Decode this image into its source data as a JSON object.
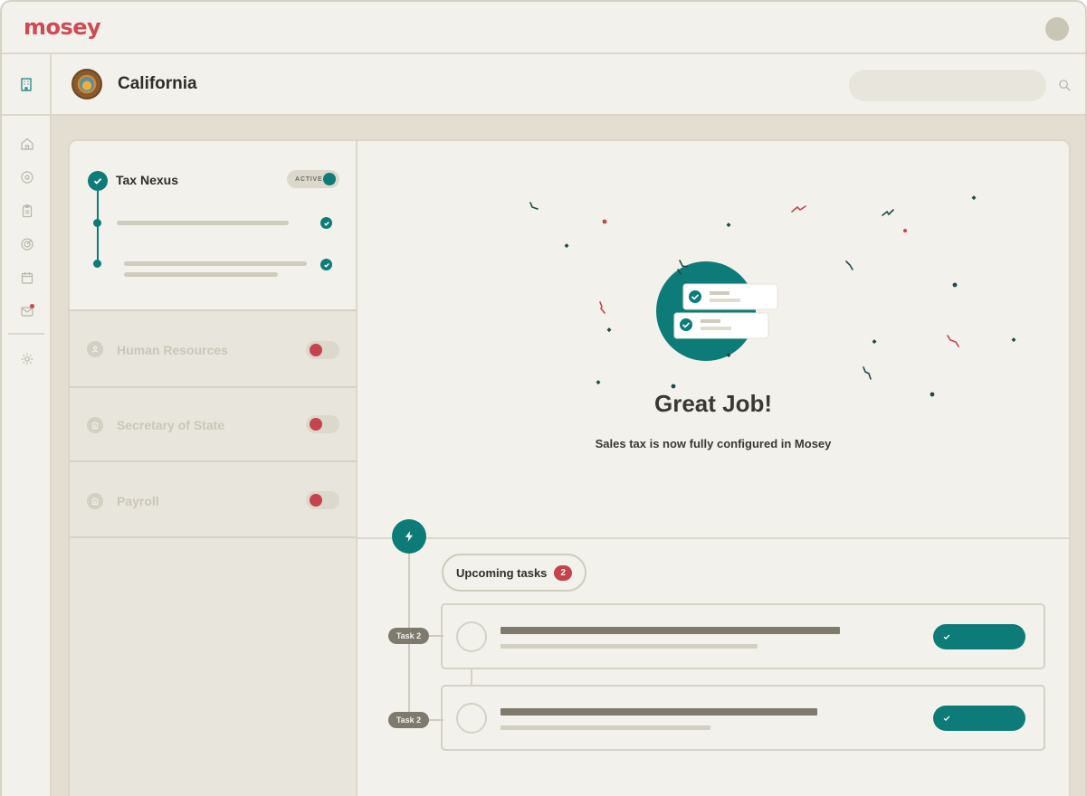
{
  "app": {
    "name": "mosey"
  },
  "header": {
    "title": "California",
    "search": {
      "placeholder": ""
    }
  },
  "sidebar": {
    "icons": [
      "building-icon",
      "home-icon",
      "location-pin-icon",
      "clipboard-icon",
      "target-icon",
      "calendar-icon",
      "mail-icon",
      "gear-icon"
    ]
  },
  "categories": {
    "active": {
      "label": "Tax Nexus",
      "status": "ACTIVE"
    },
    "items": [
      {
        "label": "Human Resources",
        "icon": "person-badge-icon"
      },
      {
        "label": "Secretary of State",
        "icon": "bank-icon"
      },
      {
        "label": "Payroll",
        "icon": "bank-icon"
      }
    ]
  },
  "success": {
    "title": "Great Job!",
    "subtitle": "Sales tax is now fully configured in Mosey"
  },
  "tasks": {
    "header": "Upcoming tasks",
    "count": "2",
    "items": [
      {
        "tag": "Task 2"
      },
      {
        "tag": "Task 2"
      }
    ]
  },
  "colors": {
    "brand": "#d04a52",
    "accent": "#0d7c78",
    "alert": "#c5434c"
  }
}
